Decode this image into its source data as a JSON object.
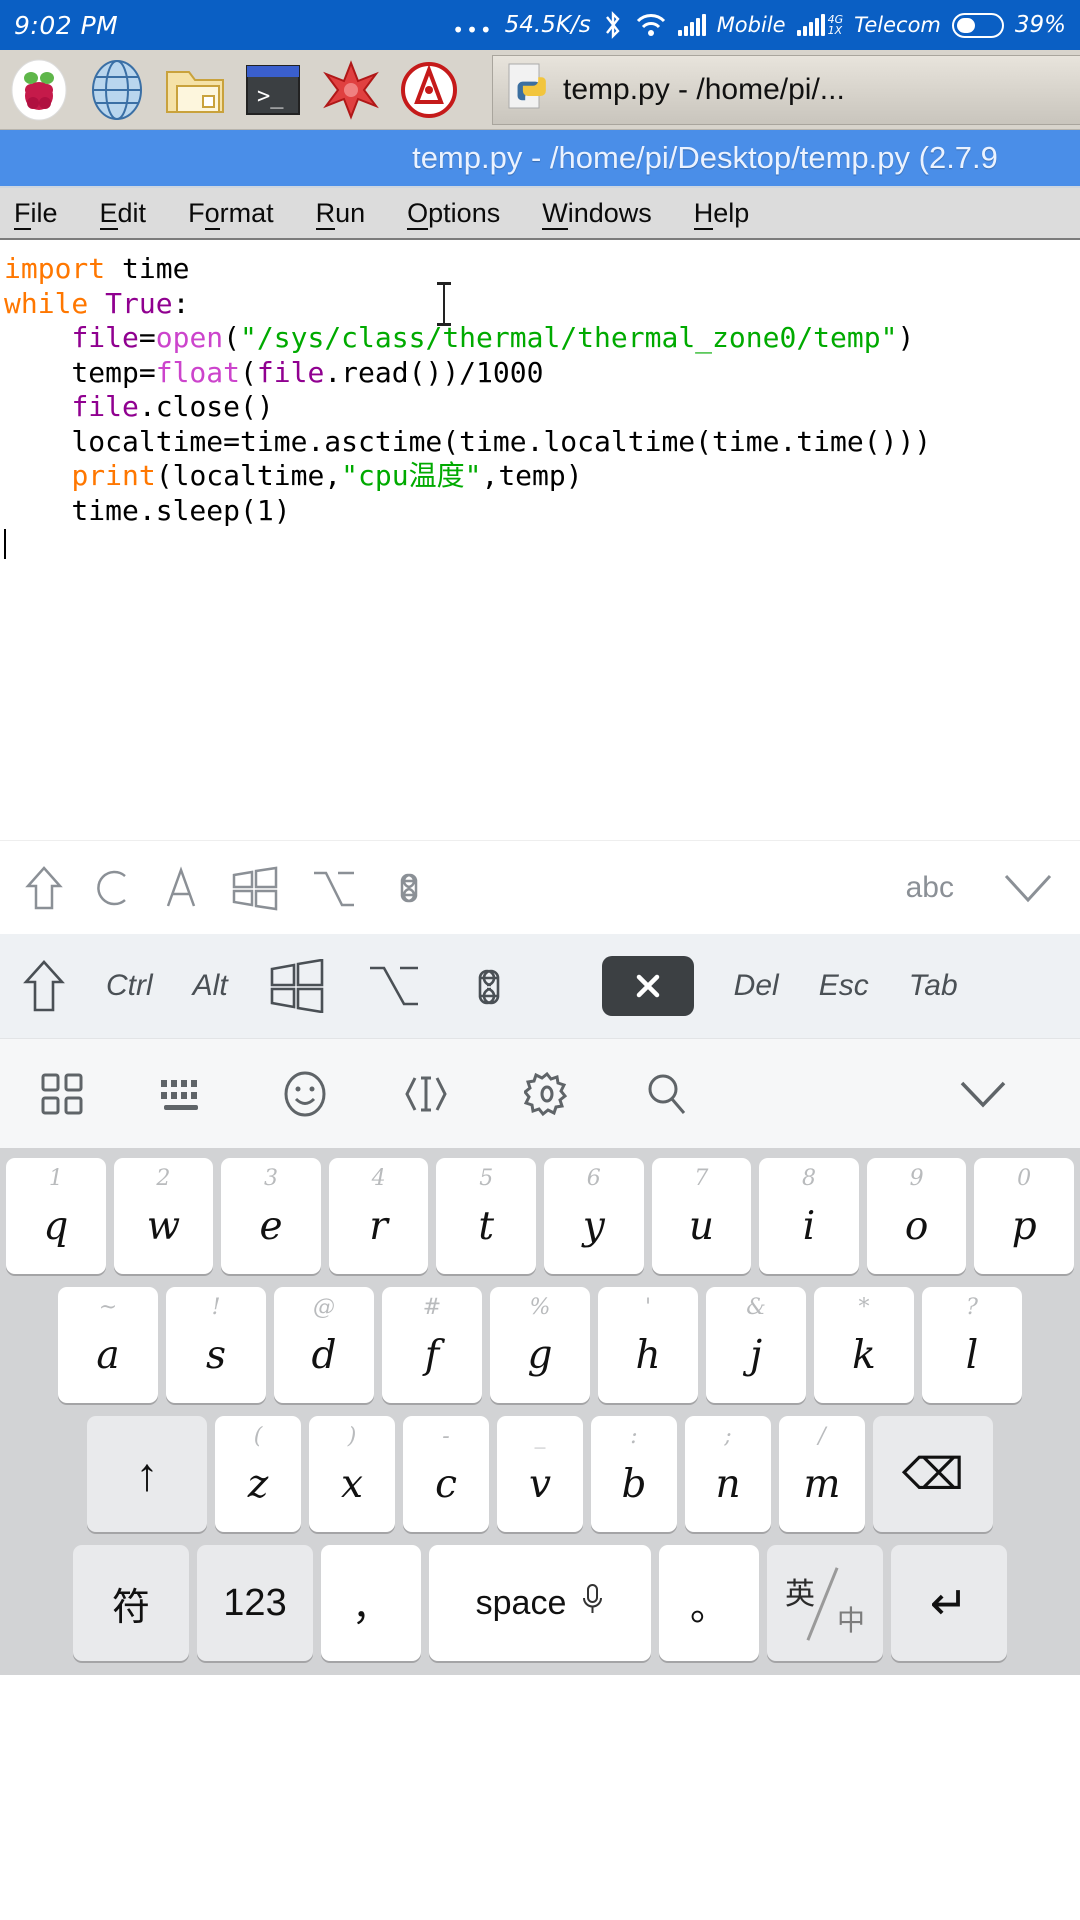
{
  "status_bar": {
    "time": "9:02 PM",
    "dots": "•••",
    "network_speed": "54.5K/s",
    "bluetooth_icon": "bluetooth-icon",
    "wifi_icon": "wifi-icon",
    "signal_icon": "signal-bars-icon",
    "carrier_1": "Mobile",
    "net_type_top": "4G",
    "net_type_bottom": "1X",
    "carrier_2": "Telecom",
    "battery_percent": "39%",
    "bg_color": "#0a5fc4"
  },
  "taskbar": {
    "icons": [
      {
        "name": "raspberry-pi-menu-icon",
        "label": "Raspberry Pi Menu"
      },
      {
        "name": "web-browser-icon",
        "label": "Web Browser"
      },
      {
        "name": "file-manager-icon",
        "label": "File Manager"
      },
      {
        "name": "terminal-icon",
        "label": "Terminal"
      },
      {
        "name": "mathematica-icon",
        "label": "Mathematica"
      },
      {
        "name": "wolfram-icon",
        "label": "Wolfram"
      }
    ],
    "window_button": {
      "icon": "python-file-icon",
      "label": "temp.py - /home/pi/..."
    }
  },
  "idle_window": {
    "title": "temp.py - /home/pi/Desktop/temp.py (2.7.9",
    "title_bar_color": "#4a8ee8",
    "menu": [
      {
        "mnemonic": "F",
        "rest": "ile"
      },
      {
        "mnemonic": "E",
        "rest": "dit"
      },
      {
        "mnemonic": "F",
        "rest": "ormat",
        "pre": "F",
        "mid": "o"
      },
      {
        "mnemonic": "R",
        "rest": "un"
      },
      {
        "mnemonic": "O",
        "rest": "ptions"
      },
      {
        "mnemonic": "W",
        "rest": "indows"
      },
      {
        "mnemonic": "H",
        "rest": "elp"
      }
    ],
    "menu_labels": [
      "File",
      "Edit",
      "Format",
      "Run",
      "Options",
      "Windows",
      "Help"
    ],
    "code_lines": [
      "import time",
      "while True:",
      "    file=open(\"/sys/class/thermal/thermal_zone0/temp\")",
      "    temp=float(file.read())/1000",
      "    file.close()",
      "    localtime=time.asctime(time.localtime(time.time()))",
      "    print(localtime,\"cpu温度\",temp)",
      "    time.sleep(1)"
    ],
    "syntax_colors": {
      "keyword": "#ff7700",
      "builtin": "#900090",
      "function": "#cc44cc",
      "string": "#00aa00",
      "text": "#000000"
    }
  },
  "shortcut_strip": {
    "icons": [
      {
        "name": "shift-icon",
        "glyph": "⇧"
      },
      {
        "name": "ctrl-letter-icon",
        "glyph": "C"
      },
      {
        "name": "alt-letter-icon",
        "glyph": "A"
      },
      {
        "name": "windows-key-icon",
        "glyph": "⊞"
      },
      {
        "name": "option-key-icon",
        "glyph": "⌥"
      },
      {
        "name": "command-key-icon",
        "glyph": "⌘"
      }
    ],
    "abc_label": "abc",
    "collapse_icon": "chevron-down-icon"
  },
  "modifier_row": {
    "keys": [
      {
        "name": "shift-key",
        "label": "⇧",
        "type": "icon"
      },
      {
        "name": "ctrl-key",
        "label": "Ctrl",
        "type": "text"
      },
      {
        "name": "alt-key",
        "label": "Alt",
        "type": "text"
      },
      {
        "name": "windows-key",
        "label": "⊞",
        "type": "icon"
      },
      {
        "name": "option-key",
        "label": "⌥",
        "type": "icon"
      },
      {
        "name": "command-key",
        "label": "⌘",
        "type": "icon"
      },
      {
        "name": "backspace-key",
        "label": "✕",
        "type": "dark"
      },
      {
        "name": "del-key",
        "label": "Del",
        "type": "text"
      },
      {
        "name": "esc-key",
        "label": "Esc",
        "type": "text"
      },
      {
        "name": "tab-key",
        "label": "Tab",
        "type": "text"
      }
    ]
  },
  "tool_row": {
    "icons": [
      {
        "name": "apps-grid-icon"
      },
      {
        "name": "keyboard-layout-icon"
      },
      {
        "name": "emoji-icon"
      },
      {
        "name": "cursor-move-icon"
      },
      {
        "name": "settings-gear-icon"
      },
      {
        "name": "search-icon"
      },
      {
        "name": "collapse-keyboard-icon"
      }
    ]
  },
  "keyboard": {
    "row1": [
      {
        "hint": "1",
        "key": "q"
      },
      {
        "hint": "2",
        "key": "w"
      },
      {
        "hint": "3",
        "key": "e"
      },
      {
        "hint": "4",
        "key": "r"
      },
      {
        "hint": "5",
        "key": "t"
      },
      {
        "hint": "6",
        "key": "y"
      },
      {
        "hint": "7",
        "key": "u"
      },
      {
        "hint": "8",
        "key": "i"
      },
      {
        "hint": "9",
        "key": "o"
      },
      {
        "hint": "0",
        "key": "p"
      }
    ],
    "row2": [
      {
        "hint": "~",
        "key": "a"
      },
      {
        "hint": "!",
        "key": "s"
      },
      {
        "hint": "@",
        "key": "d"
      },
      {
        "hint": "#",
        "key": "f"
      },
      {
        "hint": "%",
        "key": "g"
      },
      {
        "hint": "'",
        "key": "h"
      },
      {
        "hint": "&",
        "key": "j"
      },
      {
        "hint": "*",
        "key": "k"
      },
      {
        "hint": "?",
        "key": "l"
      }
    ],
    "row3": [
      {
        "hint": "",
        "key": "↑",
        "style": "grey",
        "name": "shift-key"
      },
      {
        "hint": "(",
        "key": "z"
      },
      {
        "hint": ")",
        "key": "x"
      },
      {
        "hint": "-",
        "key": "c"
      },
      {
        "hint": "_",
        "key": "v"
      },
      {
        "hint": ":",
        "key": "b"
      },
      {
        "hint": ";",
        "key": "n"
      },
      {
        "hint": "/",
        "key": "m"
      },
      {
        "hint": "",
        "key": "⌫",
        "style": "grey",
        "name": "backspace-key"
      }
    ],
    "row4": [
      {
        "key": "符",
        "name": "symbols-key",
        "style": "grey"
      },
      {
        "key": "123",
        "name": "numbers-key",
        "style": "grey"
      },
      {
        "key": "，",
        "name": "comma-key",
        "style": "white"
      },
      {
        "key": "space",
        "name": "space-key",
        "style": "white",
        "mic": "mic-icon"
      },
      {
        "key": "。",
        "name": "period-key",
        "style": "white"
      },
      {
        "key": "英/中",
        "name": "language-toggle-key",
        "style": "grey",
        "en": "英",
        "zh": "中"
      },
      {
        "key": "↵",
        "name": "enter-key",
        "style": "grey"
      }
    ]
  }
}
